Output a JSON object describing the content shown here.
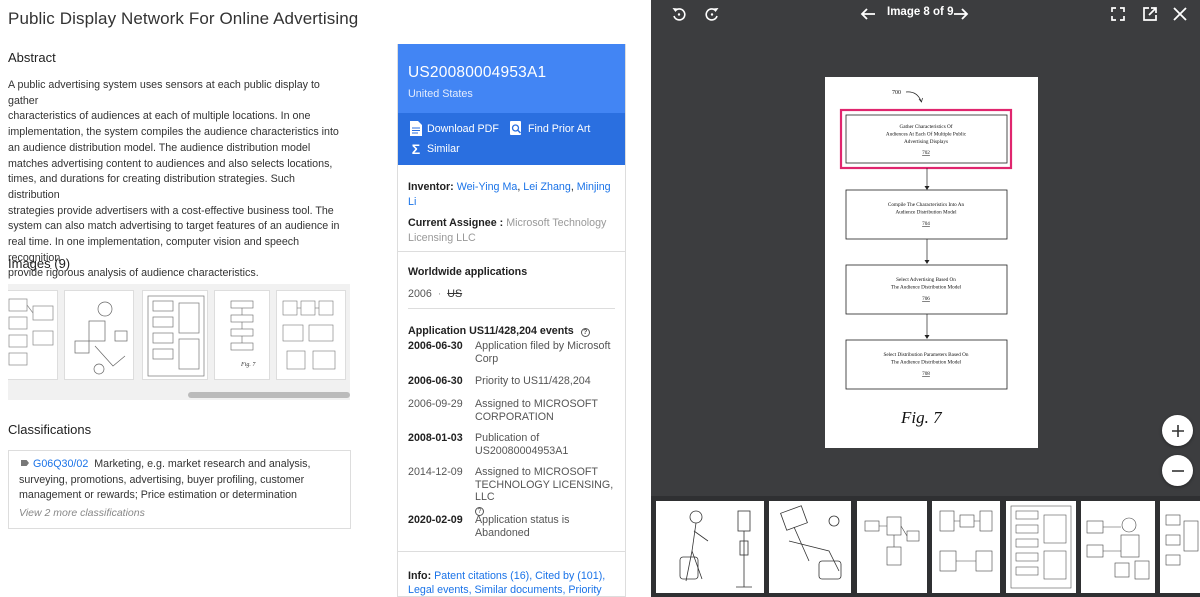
{
  "left": {
    "title": "Public Display Network For Online Advertising",
    "abstract_heading": "Abstract",
    "abstract_lines": [
      "A public advertising system uses sensors at each public display to gather",
      "characteristics of audiences at each of multiple locations. In one",
      "implementation, the system compiles the audience characteristics into",
      "an audience distribution model. The audience distribution model",
      "matches advertising content to audiences and also selects locations,",
      "times, and durations for creating distribution strategies. Such distribution",
      "strategies provide advertisers with a cost-effective business tool. The",
      "system can also match advertising to target features of an audience in",
      "real time. In one implementation, computer vision and speech recognition",
      "provide rigorous analysis of audience characteristics."
    ],
    "images_heading": "Images (9)",
    "classifications_heading": "Classifications",
    "classification": {
      "code": "G06Q30/02",
      "lines": [
        "Marketing, e.g. market research and analysis,",
        "surveying, promotions, advertising, buyer profiling, customer",
        "management or rewards; Price estimation or determination"
      ],
      "more": "View 2 more classifications"
    }
  },
  "meta": {
    "pub_number": "US20080004953A1",
    "country": "United States",
    "download_pdf": "Download PDF",
    "find_prior_art": "Find Prior Art",
    "similar": "Similar",
    "inventor_label": "Inventor:",
    "inventors": [
      "Wei-Ying Ma",
      "Lei Zhang",
      "Minjing Li"
    ],
    "assignee_label": "Current Assignee :",
    "assignee_lines": [
      "Microsoft Technology",
      "Licensing LLC"
    ],
    "worldwide_heading": "Worldwide applications",
    "worldwide_year": "2006",
    "worldwide_country": "US",
    "events_heading": "Application US11/428,204 events",
    "events": [
      {
        "date": "2006-06-30",
        "lines": [
          "Application filed by Microsoft",
          "Corp"
        ],
        "bold": true
      },
      {
        "date": "2006-06-30",
        "lines": [
          "Priority to US11/428,204"
        ],
        "bold": true
      },
      {
        "date": "2006-09-29",
        "lines": [
          "Assigned to MICROSOFT",
          "CORPORATION"
        ],
        "bold": false
      },
      {
        "date": "2008-01-03",
        "lines": [
          "Publication of",
          "US20080004953A1"
        ],
        "bold": true
      },
      {
        "date": "2014-12-09",
        "lines": [
          "Assigned to MICROSOFT",
          "TECHNOLOGY LICENSING, LLC"
        ],
        "bold": false
      },
      {
        "date": "2020-02-09",
        "lines": [
          "Application status is",
          "Abandoned"
        ],
        "bold": true
      }
    ],
    "info_label": "Info:",
    "info_line1": "Patent citations (16), Cited by (101),",
    "info_line2": "Legal events, Similar documents, Priority and"
  },
  "viewer": {
    "counter": "Image 8 of 9",
    "figure": {
      "ref": "700",
      "caption": "Fig. 7",
      "steps": [
        {
          "lines": [
            "Gather Characteristics Of",
            "Audiences At Each Of Multiple Public",
            "Advertising Displays"
          ],
          "num": "702",
          "highlighted": true
        },
        {
          "lines": [
            "Compile The Characteristics Into An",
            "Audience Distribution Model"
          ],
          "num": "704",
          "highlighted": false
        },
        {
          "lines": [
            "Select Advertising Based On",
            "The Audience Distribution Model"
          ],
          "num": "706",
          "highlighted": false
        },
        {
          "lines": [
            "Select Distribution Parameters Based On",
            "The Audience Distribution Model"
          ],
          "num": "708",
          "highlighted": false
        }
      ]
    },
    "highlight_color": "#e0266e",
    "accent_color": "#4285f4"
  }
}
